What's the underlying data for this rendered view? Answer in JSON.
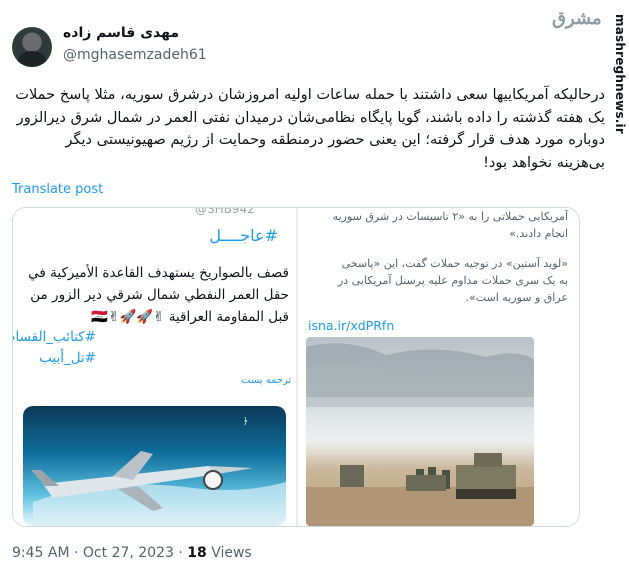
{
  "author": {
    "name": "مهدی قاسم زاده",
    "handle": "@mghasemzadeh61"
  },
  "brand": {
    "logo_text": "مشرق",
    "side_url": "mashreghnews.ir"
  },
  "tweet": {
    "text": "درحالیکه آمریکاییها سعی داشتند با حمله ساعات اولیه امروزشان درشرق سوریه، مثلا پاسخ حملات یک هفته گذشته را داده باشند، گویا پایگاه نظامی‌شان درمیدان نفتی العمر در شمال شرق دیرالزور دوباره مورد هدف قرار گرفته؛ این یعنی حضور درمنطقه وحمایت از رژیم صهیونیستی دیگر بی‌هزینه نخواهد بود!",
    "translate_label": "Translate post"
  },
  "media_left": {
    "handle": "@SHB942",
    "breaking": "#عاجــــل",
    "body": "قصف بالصواريخ يستهدف القاعدة الأميركية في حقل العمر النفطي شمال شرقي دير الزور من قبل المقاومة العراقية ✌🚀🚀✌🇮🇶",
    "tags": [
      "#كتائب_القسام",
      "#تل_أبيب"
    ],
    "translate_label": "ترجمه پست"
  },
  "media_right": {
    "lines_top": [
      "آمریکایی حملاتی را به «۲ تاسیسات در شرق سوریه",
      "انجام دادند.»"
    ],
    "lines_mid": [
      "«لوید آستین» در توجیه حملات گفت، این «پاسخی",
      "به یک سری حملات مداوم علیه پرسنل آمریکایی در",
      "عراق و سوریه است».",
      " "
    ],
    "link": "isna.ir/xdPRfn"
  },
  "footer": {
    "time": "9:45 AM",
    "date": "Oct 27, 2023",
    "sep": "·",
    "views_count": "18",
    "views_label": "Views"
  },
  "colors": {
    "accent": "#1d9bf0",
    "muted": "#536471",
    "border": "#cfd9de"
  }
}
